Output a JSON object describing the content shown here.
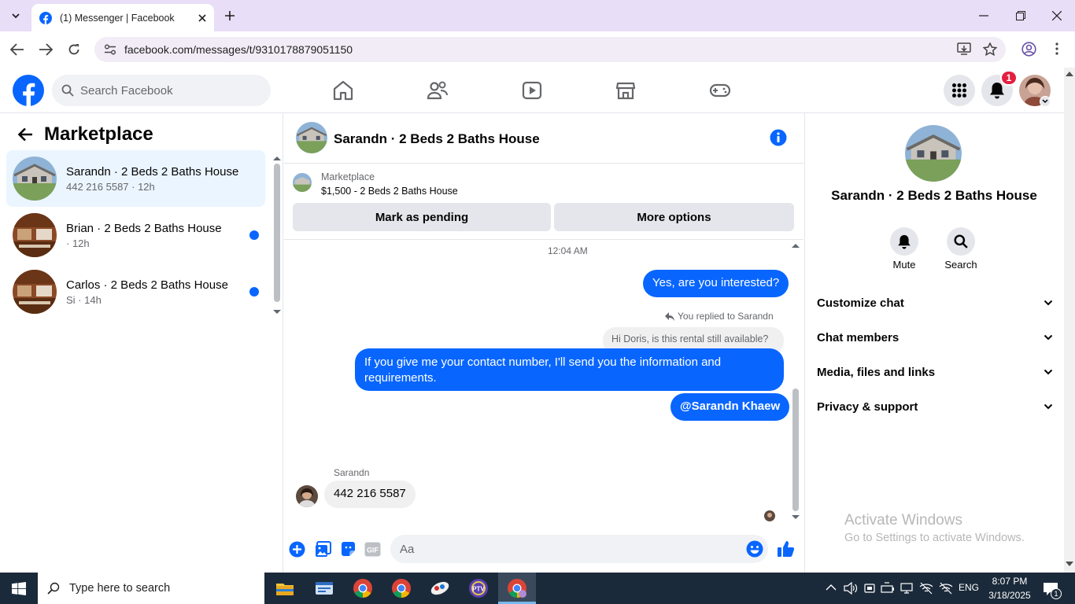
{
  "browser": {
    "tab_title": "(1) Messenger | Facebook",
    "url": "facebook.com/messages/t/9310178879051150"
  },
  "fb": {
    "search_placeholder": "Search Facebook",
    "notification_count": "1",
    "brand_color": "#0866ff"
  },
  "left": {
    "title": "Marketplace",
    "conversations": [
      {
        "name": "Sarandn · 2 Beds 2 Baths House",
        "sub": "442 216 5587 · 12h",
        "active": true,
        "unread": false
      },
      {
        "name": "Brian · 2 Beds 2 Baths House",
        "sub": "· 12h",
        "active": false,
        "unread": true
      },
      {
        "name": "Carlos · 2 Beds 2 Baths House",
        "sub": "Si · 14h",
        "active": false,
        "unread": true
      }
    ]
  },
  "chat": {
    "header_title": "Sarandn · 2 Beds 2 Baths House",
    "listing_source": "Marketplace",
    "listing_desc": "$1,500 - 2 Beds 2 Baths House",
    "mark_pending": "Mark as pending",
    "more_options": "More options",
    "timestamp": "12:04 AM",
    "msg1": "Yes, are you interested?",
    "reply_note": "You replied to Sarandn",
    "quoted": "Hi Doris, is this  rental still available?",
    "msg2": "If you give me your contact number, I'll send you the information and requirements.",
    "msg3": "@Sarandn Khaew",
    "incoming_sender": "Sarandn",
    "incoming_msg": "442 216 5587",
    "composer_placeholder": "Aa"
  },
  "right": {
    "name": "Sarandn · 2 Beds 2 Baths House",
    "mute": "Mute",
    "search": "Search",
    "sections": [
      "Customize chat",
      "Chat members",
      "Media, files and links",
      "Privacy & support"
    ]
  },
  "watermark": {
    "line1": "Activate Windows",
    "line2": "Go to Settings to activate Windows."
  },
  "taskbar": {
    "search_placeholder": "Type here to search",
    "lang": "ENG",
    "time": "8:07 PM",
    "date": "3/18/2025",
    "notif": "1"
  }
}
